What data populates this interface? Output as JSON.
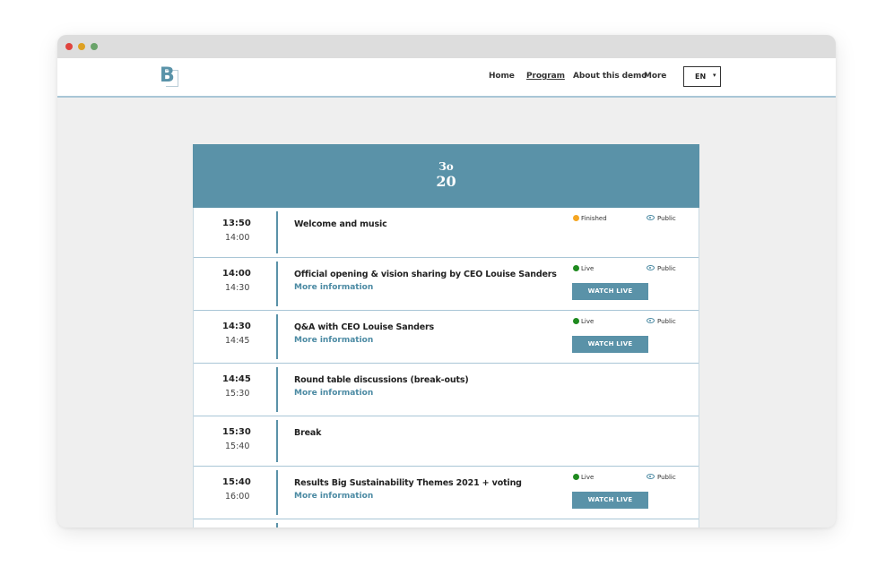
{
  "window": {
    "controls": {
      "red": "#e0443e",
      "yellow": "#dea123",
      "green": "#6aa36a"
    }
  },
  "brand": {
    "logo_letter": "B",
    "accent": "#5a92a8"
  },
  "nav": {
    "items": [
      {
        "label": "Home",
        "active": false
      },
      {
        "label": "Program",
        "active": true
      },
      {
        "label": "About this demo",
        "active": false
      },
      {
        "label": "More",
        "active": false
      }
    ],
    "language": {
      "value": "EN",
      "caret": "▾"
    }
  },
  "day": {
    "weekday": "Зо",
    "date": "20"
  },
  "sessions": [
    {
      "start": "13:50",
      "end": "14:00",
      "title": "Welcome and music",
      "more": "",
      "status": "Finished",
      "status_color": "#f5a623",
      "visibility": "Public",
      "button": ""
    },
    {
      "start": "14:00",
      "end": "14:30",
      "title": "Official opening & vision sharing by CEO Louise Sanders",
      "more": "More information",
      "status": "Live",
      "status_color": "#1f8a1f",
      "visibility": "Public",
      "button": "WATCH LIVE STREAM"
    },
    {
      "start": "14:30",
      "end": "14:45",
      "title": "Q&A with CEO Louise Sanders",
      "more": "More information",
      "status": "Live",
      "status_color": "#1f8a1f",
      "visibility": "Public",
      "button": "WATCH LIVE STREAM"
    },
    {
      "start": "14:45",
      "end": "15:30",
      "title": "Round table discussions (break-outs)",
      "more": "More information",
      "status": "",
      "status_color": "",
      "visibility": "",
      "button": ""
    },
    {
      "start": "15:30",
      "end": "15:40",
      "title": "Break",
      "more": "",
      "status": "",
      "status_color": "",
      "visibility": "",
      "button": ""
    },
    {
      "start": "15:40",
      "end": "16:00",
      "title": "Results Big Sustainability Themes 2021 + voting",
      "more": "More information",
      "status": "Live",
      "status_color": "#1f8a1f",
      "visibility": "Public",
      "button": "WATCH LIVE STREAM"
    }
  ]
}
